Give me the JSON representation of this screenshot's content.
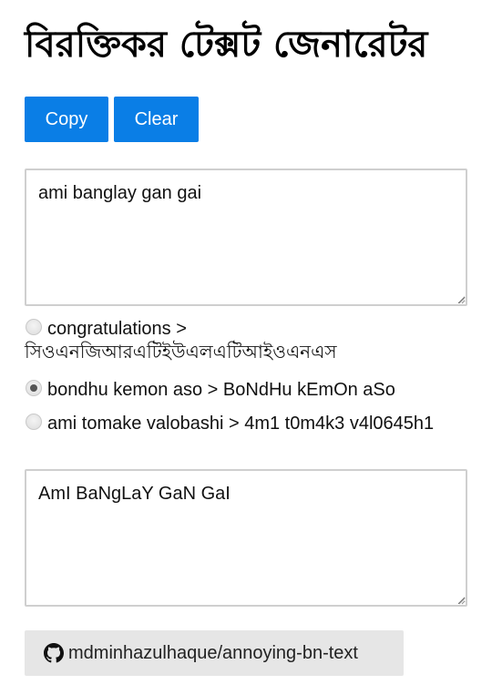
{
  "header": {
    "title": "বিরক্তিকর টেক্সট জেনারেটর"
  },
  "toolbar": {
    "copy_label": "Copy",
    "clear_label": "Clear"
  },
  "input": {
    "value": "ami banglay gan gai"
  },
  "options": [
    {
      "label": "congratulations > সিওএনজিআরএটিইউএলএটিআইওএনএস",
      "checked": false
    },
    {
      "label": "bondhu kemon aso > BoNdHu kEmOn aSo",
      "checked": true
    },
    {
      "label": "ami tomake valobashi > 4m1 t0m4k3 v4l0645h1",
      "checked": false
    }
  ],
  "output": {
    "value": "AmI BaNgLaY GaN GaI"
  },
  "footer": {
    "repo_link_label": "mdminhazulhaque/annoying-bn-text",
    "repo_icon": "github-icon"
  },
  "colors": {
    "button_bg": "#0a7ee6",
    "button_text": "#ffffff",
    "footer_bg": "#e6e6e6",
    "textbox_border": "#cfcfcf"
  }
}
